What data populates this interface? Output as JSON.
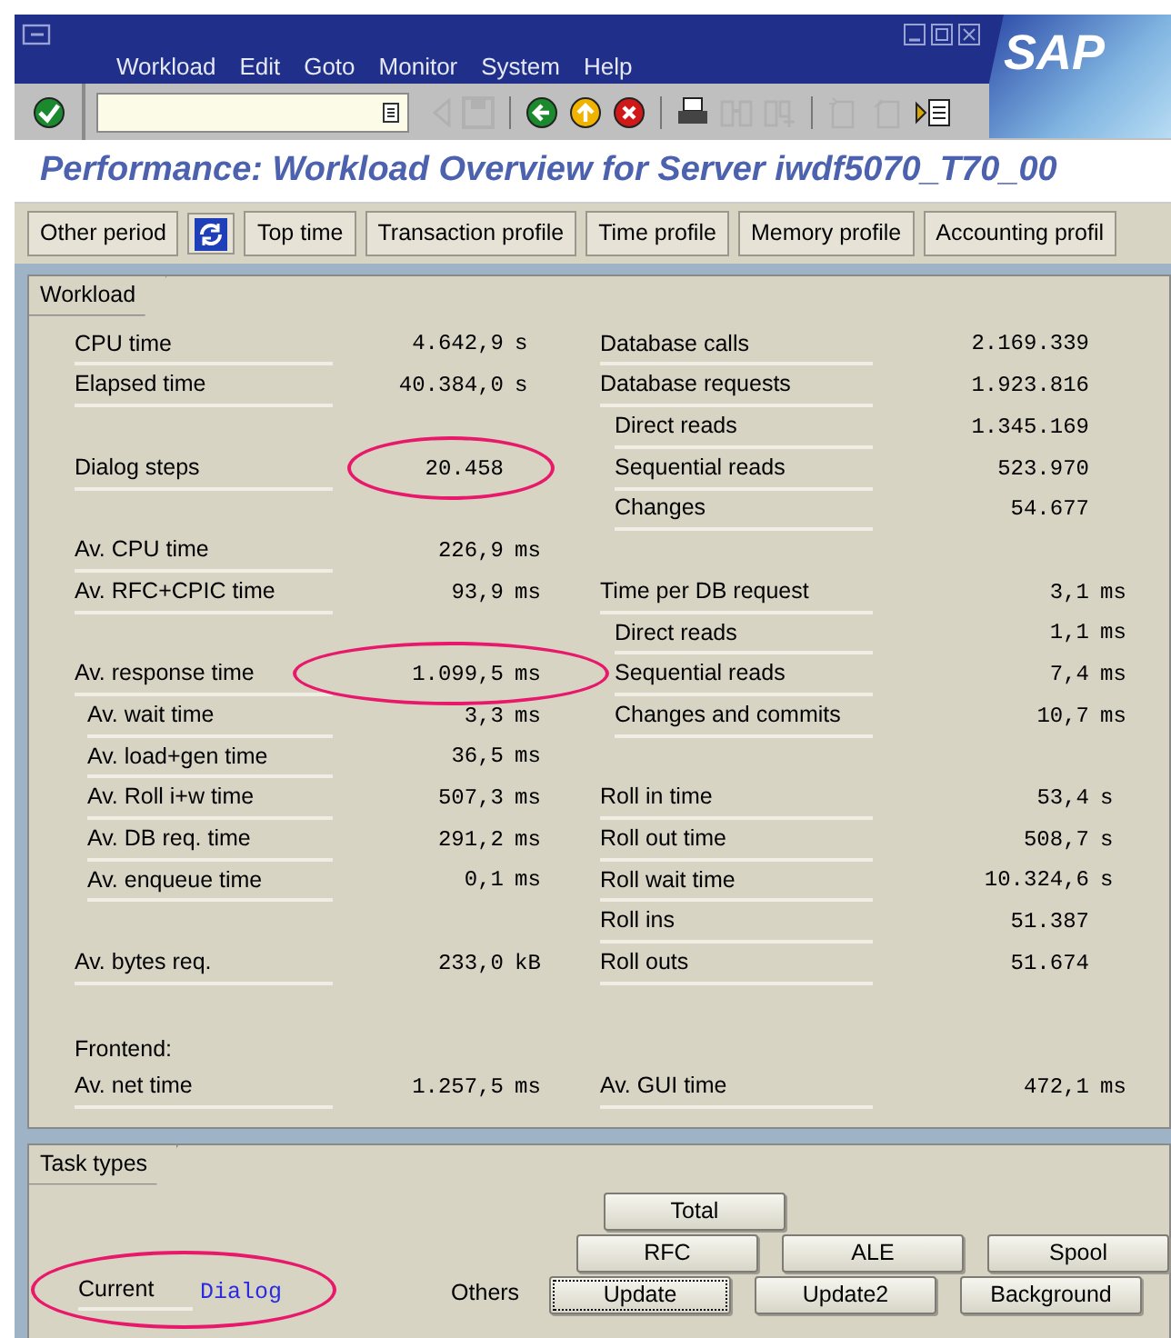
{
  "window": {
    "menu": [
      "Workload",
      "Edit",
      "Goto",
      "Monitor",
      "System",
      "Help"
    ],
    "logo": "SAP"
  },
  "toolbar": [
    {
      "kind": "enter",
      "disabled": false
    },
    {
      "kind": "field"
    },
    {
      "kind": "back-small",
      "disabled": true
    },
    {
      "kind": "save",
      "disabled": true
    },
    {
      "kind": "sep"
    },
    {
      "kind": "back",
      "disabled": false
    },
    {
      "kind": "exit",
      "disabled": false
    },
    {
      "kind": "cancel",
      "disabled": false
    },
    {
      "kind": "sep"
    },
    {
      "kind": "print",
      "disabled": false
    },
    {
      "kind": "find",
      "disabled": true
    },
    {
      "kind": "find-next",
      "disabled": true
    },
    {
      "kind": "sep"
    },
    {
      "kind": "new-session",
      "disabled": true
    },
    {
      "kind": "shortcut",
      "disabled": true
    },
    {
      "kind": "layout",
      "disabled": false
    }
  ],
  "title": "Performance: Workload Overview for Server iwdf5070_T70_00",
  "app_toolbar": [
    {
      "kind": "text",
      "label": "Other period"
    },
    {
      "kind": "refresh"
    },
    {
      "kind": "text",
      "label": "Top time"
    },
    {
      "kind": "text",
      "label": "Transaction profile"
    },
    {
      "kind": "text",
      "label": "Time profile"
    },
    {
      "kind": "text",
      "label": "Memory profile"
    },
    {
      "kind": "text",
      "label": "Accounting profil"
    }
  ],
  "workload": {
    "tab": "Workload",
    "rows": [
      {
        "left": {
          "label": "CPU time",
          "value": "4.642,9",
          "unit": "s",
          "indent": false,
          "circled": false
        },
        "right": {
          "label": "Database calls",
          "value": "2.169.339",
          "indent": false,
          "circled": false
        }
      },
      {
        "left": {
          "label": "Elapsed time",
          "value": "40.384,0",
          "unit": "s",
          "indent": false,
          "circled": false
        },
        "right": {
          "label": "Database requests",
          "value": "1.923.816",
          "indent": false,
          "circled": false
        }
      },
      {
        "right": {
          "label": "Direct reads",
          "value": "1.345.169",
          "indent": true,
          "circled": false
        }
      },
      {
        "left": {
          "label": "Dialog steps",
          "value": "20.458",
          "indent": false,
          "circled": true
        },
        "right": {
          "label": "Sequential reads",
          "value": "523.970",
          "indent": true,
          "circled": false
        }
      },
      {
        "right": {
          "label": "Changes",
          "value": "54.677",
          "indent": true,
          "circled": false
        }
      },
      {
        "left": {
          "label": "Av. CPU time",
          "value": "226,9",
          "unit": "ms",
          "indent": false,
          "circled": false
        }
      },
      {
        "left": {
          "label": "Av. RFC+CPIC time",
          "value": "93,9",
          "unit": "ms",
          "indent": false,
          "circled": false
        },
        "right": {
          "label": "Time per DB request",
          "value": "3,1",
          "unit": "ms",
          "indent": false,
          "circled": false
        }
      },
      {
        "right": {
          "label": "Direct reads",
          "value": "1,1",
          "unit": "ms",
          "indent": true,
          "circled": false
        }
      },
      {
        "left": {
          "label": "Av. response time",
          "value": "1.099,5",
          "unit": "ms",
          "indent": false,
          "circled": true
        },
        "right": {
          "label": "Sequential reads",
          "value": "7,4",
          "unit": "ms",
          "indent": true,
          "circled": false
        }
      },
      {
        "left": {
          "label": "Av. wait time",
          "value": "3,3",
          "unit": "ms",
          "indent": true,
          "circled": false
        },
        "right": {
          "label": "Changes and commits",
          "value": "10,7",
          "unit": "ms",
          "indent": true,
          "circled": false
        }
      },
      {
        "left": {
          "label": "Av. load+gen time",
          "value": "36,5",
          "unit": "ms",
          "indent": true,
          "circled": false
        }
      },
      {
        "left": {
          "label": "Av. Roll i+w time",
          "value": "507,3",
          "unit": "ms",
          "indent": true,
          "circled": false
        },
        "right": {
          "label": "Roll in time",
          "value": "53,4",
          "unit": "s",
          "indent": false,
          "circled": false
        }
      },
      {
        "left": {
          "label": "Av. DB req. time",
          "value": "291,2",
          "unit": "ms",
          "indent": true,
          "circled": false
        },
        "right": {
          "label": "Roll out time",
          "value": "508,7",
          "unit": "s",
          "indent": false,
          "circled": false
        }
      },
      {
        "left": {
          "label": "Av. enqueue time",
          "value": "0,1",
          "unit": "ms",
          "indent": true,
          "circled": false
        },
        "right": {
          "label": "Roll wait time",
          "value": "10.324,6",
          "unit": "s",
          "indent": false,
          "circled": false
        }
      },
      {
        "right": {
          "label": "Roll ins",
          "value": "51.387",
          "indent": false,
          "circled": false
        }
      },
      {
        "left": {
          "label": "Av. bytes req.",
          "value": "233,0",
          "unit": "kB",
          "indent": false,
          "circled": false
        },
        "right": {
          "label": "Roll outs",
          "value": "51.674",
          "indent": false,
          "circled": false
        }
      },
      {
        "heading": "Frontend:"
      },
      {
        "left": {
          "label": "Av. net time",
          "value": "1.257,5",
          "unit": "ms",
          "indent": false,
          "circled": false
        },
        "right": {
          "label": "Av. GUI time",
          "value": "472,1",
          "unit": "ms",
          "indent": false,
          "circled": false
        }
      }
    ]
  },
  "task_types": {
    "tab": "Task types",
    "current_label": "Current",
    "current_value": "Dialog",
    "circled": true,
    "others_label": "Others",
    "button_rows": [
      [
        {
          "label": "Total",
          "focused": false
        }
      ],
      [
        {
          "label": "RFC",
          "focused": false
        },
        {
          "label": "ALE",
          "focused": false
        },
        {
          "label": "Spool",
          "focused": false
        }
      ],
      [
        {
          "label": "Update",
          "focused": true
        },
        {
          "label": "Update2",
          "focused": false
        },
        {
          "label": "Background",
          "focused": false
        }
      ]
    ]
  }
}
